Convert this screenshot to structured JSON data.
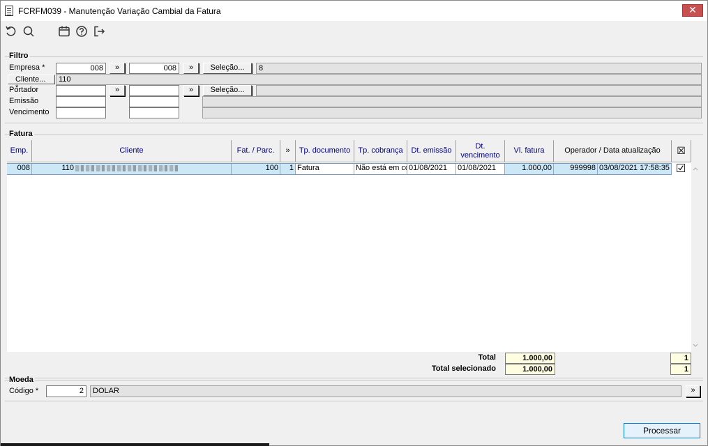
{
  "window": {
    "title": "FCRFM039 - Manutenção Variação Cambial da Fatura",
    "close_glyph": "✕"
  },
  "toolbar": {
    "icons": [
      "undo-icon",
      "search-icon",
      "calendar-icon",
      "help-icon",
      "exit-icon"
    ]
  },
  "filtro": {
    "group_label": "Filtro",
    "empresa": {
      "label": "Empresa *",
      "from": "008",
      "to": "008",
      "selecao_label": "Seleção...",
      "selecao_value": "8"
    },
    "cliente": {
      "label": "Cliente... *",
      "value": "110"
    },
    "portador": {
      "label": "Portador",
      "from": "",
      "to": "",
      "selecao_label": "Seleção...",
      "selecao_value": ""
    },
    "emissao": {
      "label": "Emissão",
      "from": "",
      "to": ""
    },
    "vencimento": {
      "label": "Vencimento",
      "from": "",
      "to": ""
    },
    "arrow_glyph": "»"
  },
  "fatura": {
    "group_label": "Fatura",
    "columns": [
      "Emp.",
      "Cliente",
      "Fat. / Parc.",
      "»",
      "Tp. documento",
      "Tp. cobrança",
      "Dt. emissão",
      "Dt. vencimento",
      "Vl. fatura",
      "Operador / Data atualização",
      "☒"
    ],
    "rows": [
      {
        "emp": "008",
        "cliente_cod": "110",
        "fatura": "100",
        "parcela": "1",
        "tp_documento": "Fatura",
        "tp_cobranca": "Não está em cobrança",
        "dt_emissao": "01/08/2021",
        "dt_vencimento": "01/08/2021",
        "vl_fatura": "1.000,00",
        "operador": "999998",
        "data_atualizacao": "03/08/2021 17:58:35",
        "selected": true
      }
    ],
    "totals": {
      "total_label": "Total",
      "total_value": "1.000,00",
      "total_count": "1",
      "selecionado_label": "Total selecionado",
      "selecionado_value": "1.000,00",
      "selecionado_count": "1"
    }
  },
  "moeda": {
    "group_label": "Moeda",
    "codigo_label": "Código *",
    "codigo_value": "2",
    "descricao": "DOLAR",
    "arrow_glyph": "»"
  },
  "actions": {
    "processar_label": "Processar"
  }
}
